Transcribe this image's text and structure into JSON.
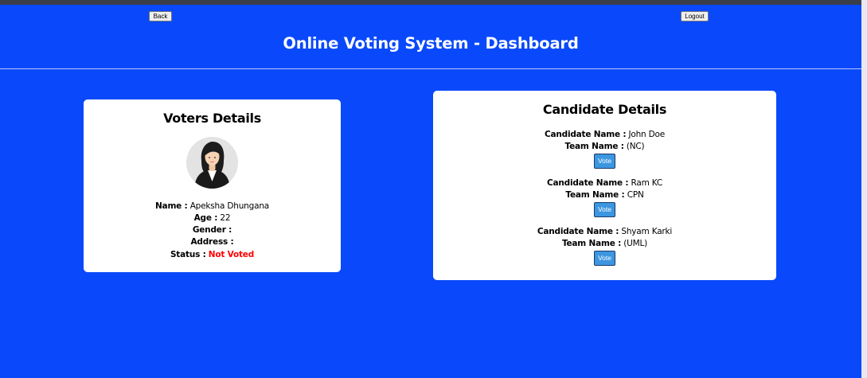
{
  "header": {
    "back_label": "Back",
    "logout_label": "Logout",
    "title": "Online Voting System - Dashboard"
  },
  "voter": {
    "heading": "Voters Details",
    "name_label": "Name :",
    "name_value": "Apeksha Dhungana",
    "age_label": "Age :",
    "age_value": "22",
    "gender_label": "Gender :",
    "gender_value": "",
    "address_label": "Address :",
    "address_value": "",
    "status_label": "Status :",
    "status_value": "Not Voted"
  },
  "candidates": {
    "heading": "Candidate Details",
    "name_label": "Candidate Name :",
    "team_label": "Team Name :",
    "vote_label": "Vote",
    "items": [
      {
        "name": "John Doe",
        "team": "(NC)"
      },
      {
        "name": "Ram KC",
        "team": "CPN"
      },
      {
        "name": "Shyam Karki",
        "team": "(UML)"
      }
    ]
  },
  "colors": {
    "background": "#0a49fb",
    "card": "#ffffff",
    "status_not_voted": "#ff0000",
    "vote_button": "#3c96e0"
  }
}
